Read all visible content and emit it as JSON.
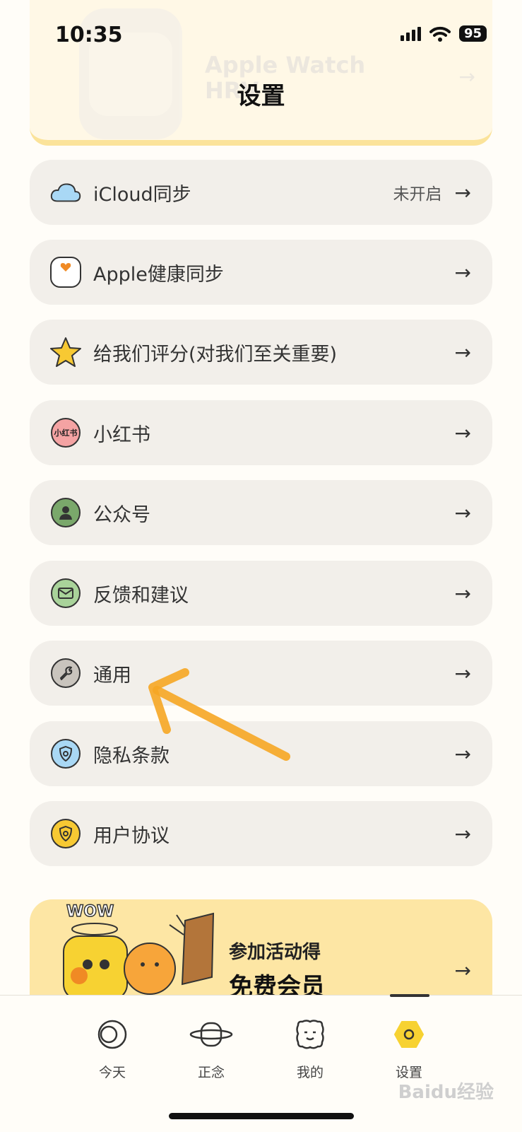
{
  "status_bar": {
    "time": "10:35",
    "battery": "95"
  },
  "header": {
    "title": "设置"
  },
  "promo_top": {
    "title_line1": "Apple Watch",
    "title_line2": "HRV",
    "arrow": "→"
  },
  "settings": [
    {
      "label": "iCloud同步",
      "status": "未开启",
      "arrow": "→",
      "icon": "cloud-icon"
    },
    {
      "label": "Apple健康同步",
      "status": "",
      "arrow": "→",
      "icon": "heart-icon"
    },
    {
      "label": "给我们评分(对我们至关重要)",
      "status": "",
      "arrow": "→",
      "icon": "star-icon"
    },
    {
      "label": "小红书",
      "status": "",
      "arrow": "→",
      "icon": "xiaohongshu-icon",
      "icon_text": "小红书"
    },
    {
      "label": "公众号",
      "status": "",
      "arrow": "→",
      "icon": "person-icon"
    },
    {
      "label": "反馈和建议",
      "status": "",
      "arrow": "→",
      "icon": "mail-icon"
    },
    {
      "label": "通用",
      "status": "",
      "arrow": "→",
      "icon": "wrench-icon"
    },
    {
      "label": "隐私条款",
      "status": "",
      "arrow": "→",
      "icon": "privacy-shield-icon"
    },
    {
      "label": "用户协议",
      "status": "",
      "arrow": "→",
      "icon": "agreement-shield-icon"
    }
  ],
  "promo_bottom": {
    "line1": "参加活动得",
    "line2": "免费会员",
    "arrow": "→",
    "badge": "WOW"
  },
  "tabbar": [
    {
      "label": "今天",
      "icon": "circle-moon-icon"
    },
    {
      "label": "正念",
      "icon": "planet-icon"
    },
    {
      "label": "我的",
      "icon": "face-icon"
    },
    {
      "label": "设置",
      "icon": "hexagon-icon",
      "active": true
    }
  ],
  "watermark": "Baidu经验",
  "colors": {
    "accent": "#fde6a4",
    "row_bg": "#f2efea",
    "annotation_arrow": "#f6a623"
  }
}
